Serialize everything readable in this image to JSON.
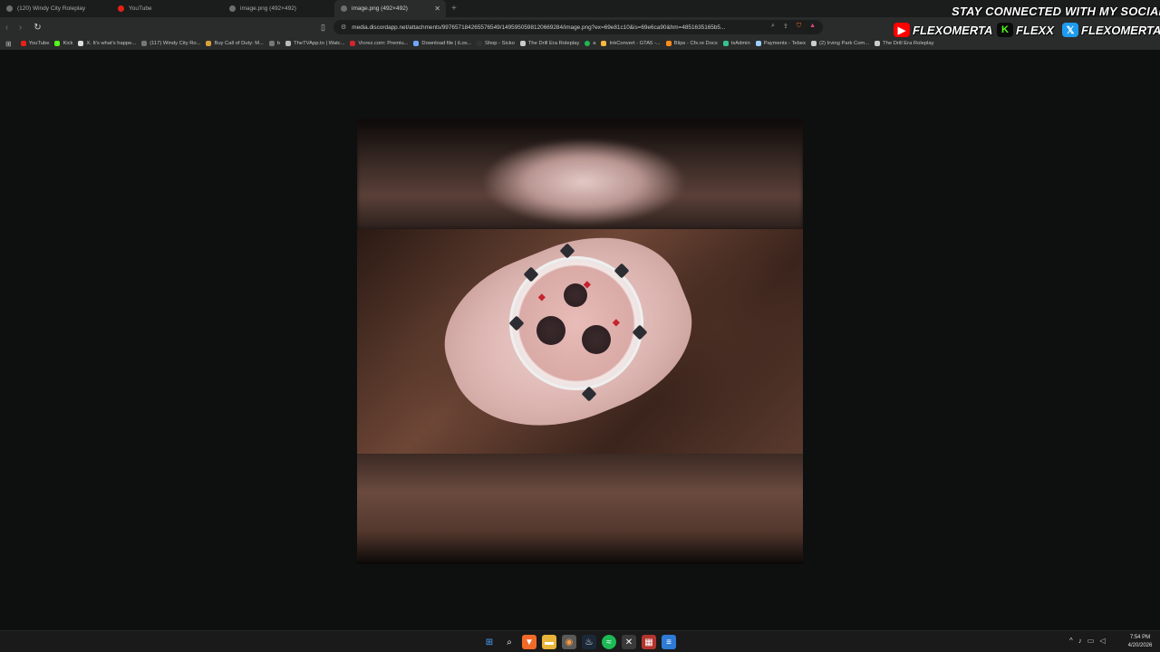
{
  "browser": {
    "tabs": [
      {
        "title": "(120) Windy City Roleplay",
        "active": false
      },
      {
        "title": "YouTube",
        "active": false
      },
      {
        "title": "image.png (492×492)",
        "active": false
      },
      {
        "title": "image.png (492×492)",
        "active": true
      }
    ],
    "new_tab_glyph": "+",
    "url": "media.discordapp.net/attachments/997657184265576549/1495950598120669284/image.png?ex=69e81c10&is=69e6ca90&hm=4851635165b5...",
    "bookmarks": [
      {
        "label": "YouTube",
        "icon": "youtube-icon",
        "color": "#e62117"
      },
      {
        "label": "Kick",
        "icon": "kick-icon",
        "color": "#53fc18"
      },
      {
        "label": "X. It's what's happe...",
        "icon": "x-icon",
        "color": "#dddddd"
      },
      {
        "label": "(117) Windy City Ro...",
        "icon": "globe-icon",
        "color": "#888888"
      },
      {
        "label": "Buy Call of Duty: M...",
        "icon": "bookmark-icon",
        "color": "#d9a13a"
      },
      {
        "label": "b",
        "icon": "globe-icon",
        "color": "#888888"
      },
      {
        "label": "TheTVApp.to | Watc...",
        "icon": "tv-icon",
        "color": "#bbbbbb"
      },
      {
        "label": "Vicrez.com: Premiu...",
        "icon": "vicrez-icon",
        "color": "#d0252b"
      },
      {
        "label": "Download file | iLov...",
        "icon": "diamond-icon",
        "color": "#6fa8ff"
      },
      {
        "label": "Shop - Sicko",
        "icon": "shop-icon",
        "color": "#333333"
      },
      {
        "label": "The Drill Era Roleplay",
        "icon": "discord-icon",
        "color": "#cccccc"
      },
      {
        "label": "a",
        "icon": "spotify-icon",
        "color": "#1db954"
      },
      {
        "label": "InkConvert - GTA5 -...",
        "icon": "inkconvert-icon",
        "color": "#f6b93b"
      },
      {
        "label": "Blips - Cfx.re Docs",
        "icon": "cfx-icon",
        "color": "#ff8c1a"
      },
      {
        "label": "txAdmin",
        "icon": "txadmin-icon",
        "color": "#31c48d"
      },
      {
        "label": "Payments - Tebex",
        "icon": "tebex-icon",
        "color": "#9ad0ff"
      },
      {
        "label": "(2) Irving Park Com...",
        "icon": "discord-icon",
        "color": "#cccccc"
      },
      {
        "label": "The Drill Era Roleplay",
        "icon": "discord-icon",
        "color": "#cccccc"
      }
    ]
  },
  "overlay": {
    "heading": "STAY CONNECTED WITH MY SOCIALS",
    "socials": [
      {
        "platform": "youtube",
        "name": "FLEXOMERTA",
        "color": "#ff0000",
        "glyph": "▶"
      },
      {
        "platform": "kick",
        "name": "FLEXX",
        "color": "#53fc18",
        "glyph": "K"
      },
      {
        "platform": "x",
        "name": "FLEXOMERTA",
        "color": "#1d9bf0",
        "glyph": "𝕏"
      }
    ]
  },
  "taskbar": {
    "clock_time": "7:54 PM",
    "clock_date": "4/20/2026"
  },
  "colors": {
    "background": "#0e100f",
    "chrome": "#2a2b2b",
    "tabstrip": "#1b1c1c"
  }
}
